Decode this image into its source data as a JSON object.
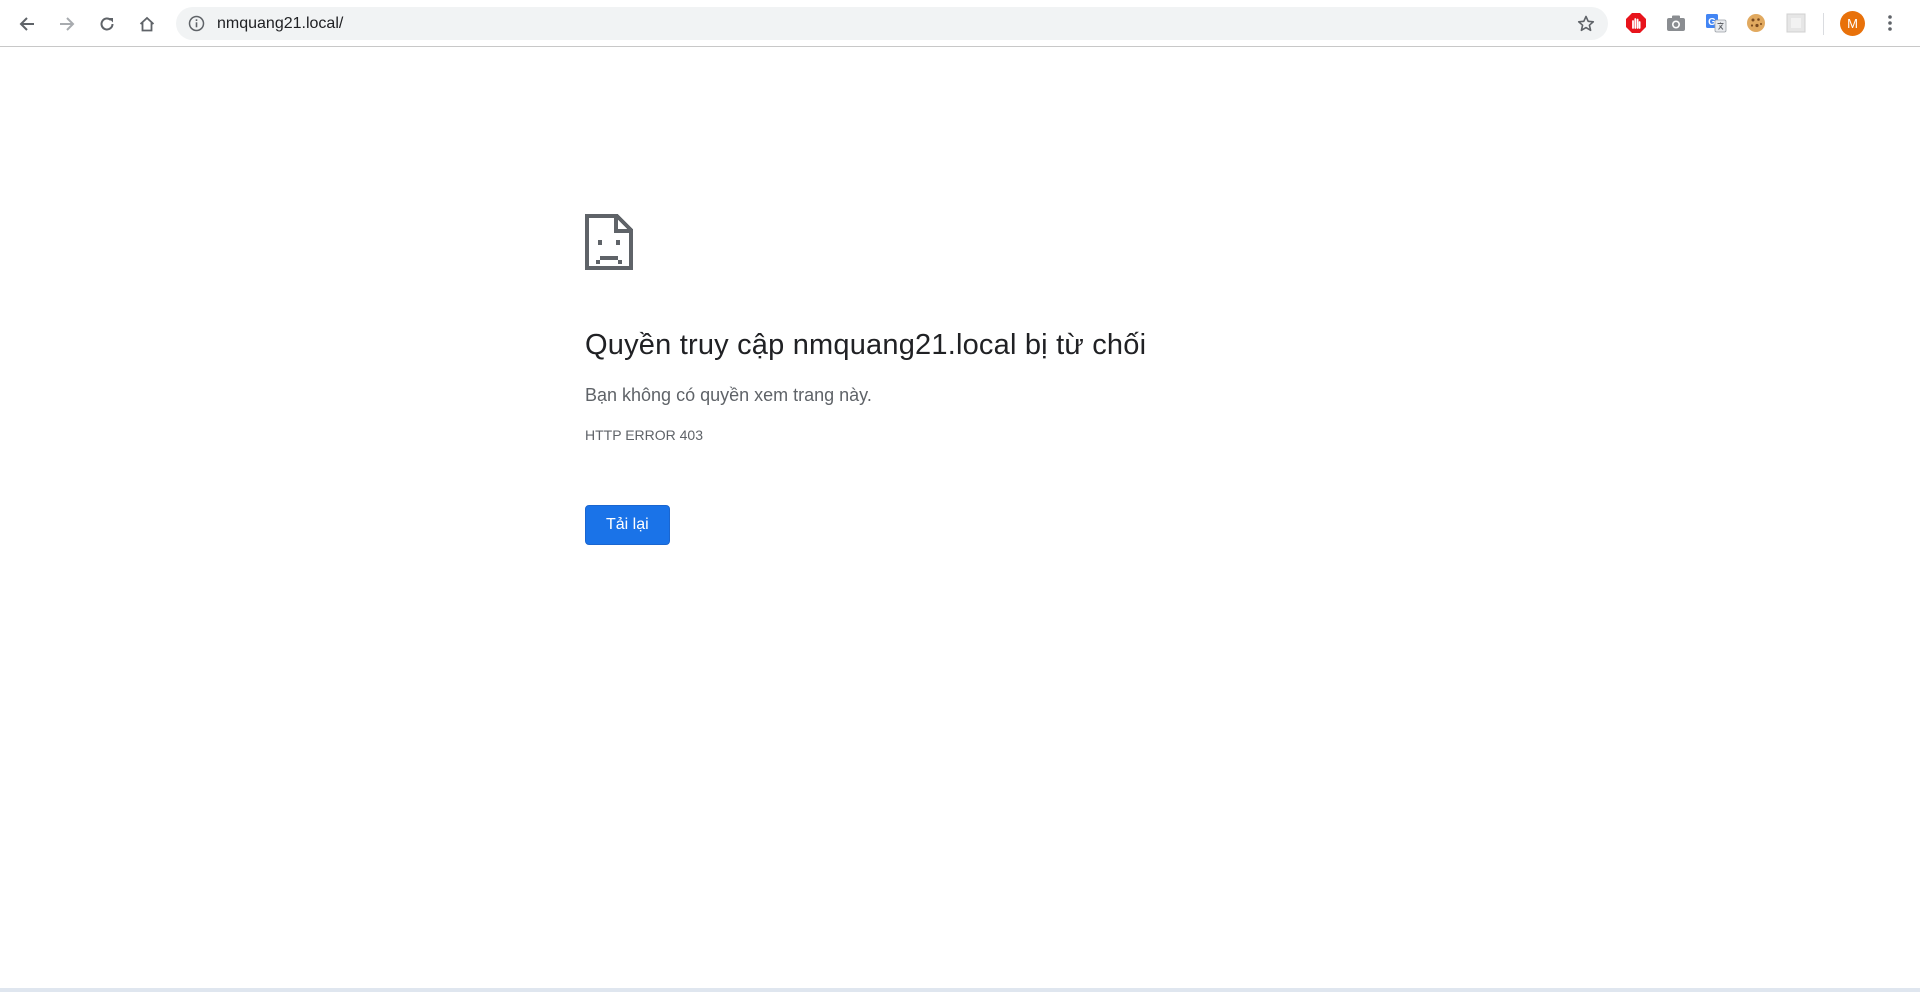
{
  "browser": {
    "url": "nmquang21.local/",
    "profile_initial": "M",
    "profile_color": "#e8710a",
    "icons": {
      "back": "back-arrow-icon",
      "forward": "forward-arrow-icon",
      "reload": "reload-icon",
      "home": "home-icon",
      "site_info": "info-icon",
      "bookmark": "star-icon",
      "menu": "kebab-menu-icon"
    },
    "extensions": [
      "adblock-icon",
      "camera-icon",
      "translate-icon",
      "cookie-icon",
      "blank-extension-icon"
    ]
  },
  "error_page": {
    "icon": "sad-page-icon",
    "title": "Quyền truy cập nmquang21.local bị từ chối",
    "message": "Bạn không có quyền xem trang này.",
    "code": "HTTP ERROR 403",
    "reload_label": "Tải lại",
    "accent_color": "#1a73e8"
  }
}
